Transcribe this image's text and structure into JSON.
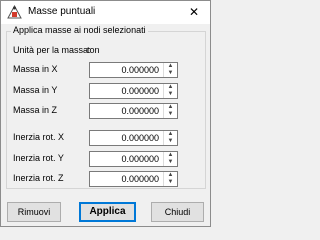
{
  "window": {
    "title": "Masse puntuali",
    "close_glyph": "✕"
  },
  "group": {
    "legend": "Applica masse ai nodi selezionati"
  },
  "unit": {
    "label": "Unità per la massa:",
    "value": "ton"
  },
  "fields": [
    {
      "label": "Massa in X",
      "value": "0.000000"
    },
    {
      "label": "Massa in Y",
      "value": "0.000000"
    },
    {
      "label": "Massa in Z",
      "value": "0.000000"
    },
    {
      "label": "Inerzia rot. X",
      "value": "0.000000"
    },
    {
      "label": "Inerzia rot. Y",
      "value": "0.000000"
    },
    {
      "label": "Inerzia rot. Z",
      "value": "0.000000"
    }
  ],
  "buttons": {
    "remove": "Rimuovi",
    "apply": "Applica",
    "close": "Chiudi"
  },
  "colors": {
    "accent": "#0078d7",
    "icon_red": "#d23a2b"
  }
}
